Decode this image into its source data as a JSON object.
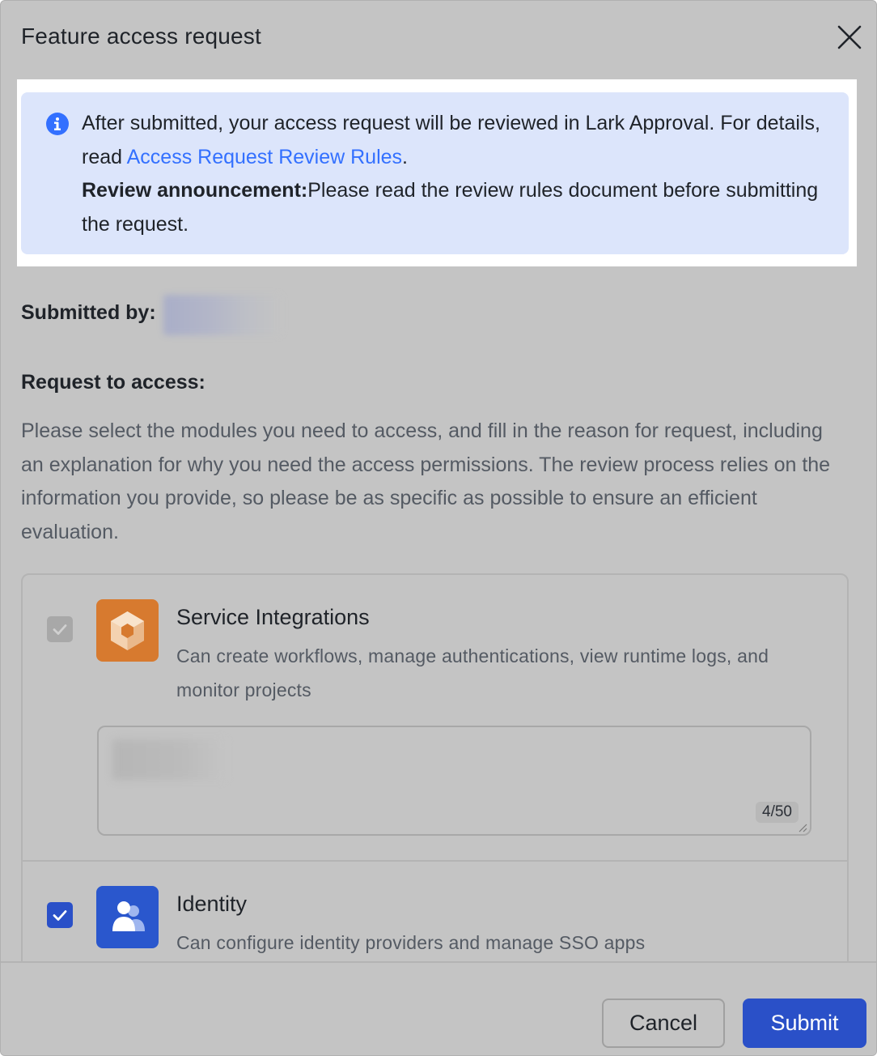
{
  "dialog": {
    "title": "Feature access request",
    "notice": {
      "line1_prefix": "After submitted, your access request will be reviewed in Lark Approval. For details, read ",
      "link_text": "Access Request Review Rules",
      "line1_suffix": ".",
      "announcement_label": "Review announcement:",
      "announcement_text": "Please read the review rules document before submitting the request."
    },
    "submitted_by_label": "Submitted by:",
    "request_heading": "Request to access:",
    "request_description": "Please select the modules you need to access, and fill in the reason for request, including an explanation for why you need the access permissions. The review process relies on the information you provide, so please be as specific as possible to ensure an efficient evaluation.",
    "modules": [
      {
        "name": "Service Integrations",
        "description": "Can create workflows, manage authentications, view runtime logs, and monitor projects",
        "checked": true,
        "disabled": true,
        "icon": "cube-icon",
        "reason_counter": "4/50"
      },
      {
        "name": "Identity",
        "description": "Can configure identity providers and manage SSO apps",
        "checked": true,
        "disabled": false,
        "icon": "users-icon"
      }
    ],
    "buttons": {
      "cancel": "Cancel",
      "submit": "Submit"
    },
    "colors": {
      "accent": "#3370ff",
      "primary_button": "#2a50c8",
      "notice_bg": "#dce5fb",
      "service_icon_bg": "#d77a2f",
      "identity_icon_bg": "#2a57cd"
    }
  }
}
